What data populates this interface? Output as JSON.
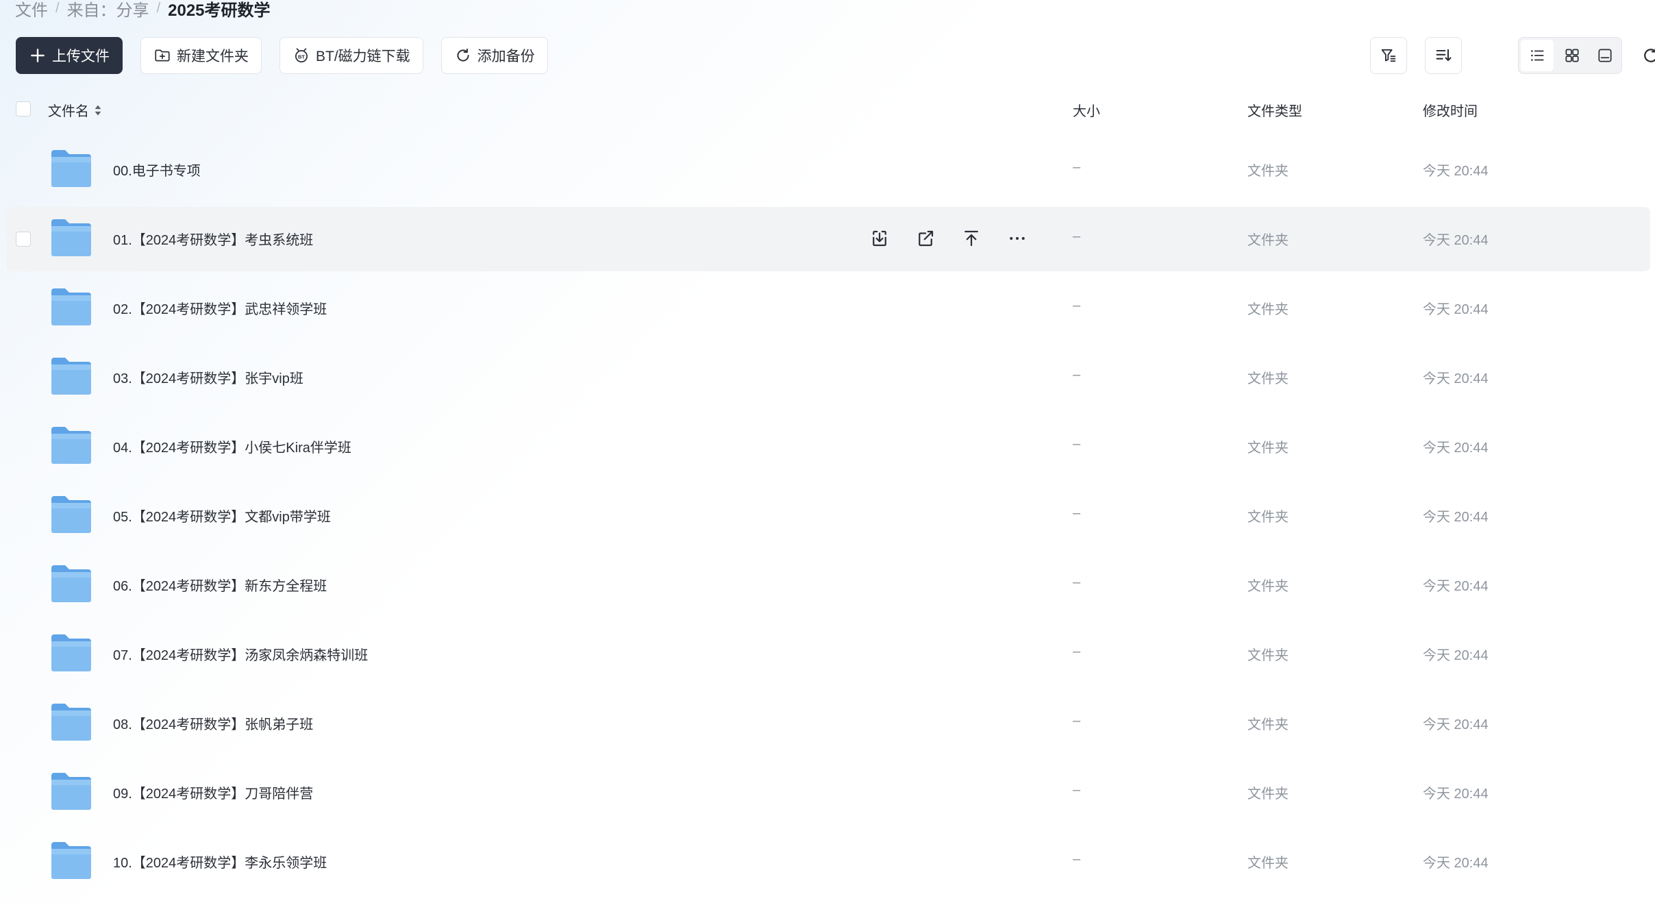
{
  "breadcrumb": {
    "root": "文件",
    "source": "来自：分享",
    "current": "2025考研数学",
    "separator": "/"
  },
  "toolbar": {
    "upload": "上传文件",
    "new_folder": "新建文件夹",
    "bt_download": "BT/磁力链下载",
    "add_backup": "添加备份"
  },
  "columns": {
    "name": "文件名",
    "size": "大小",
    "type": "文件类型",
    "modified": "修改时间"
  },
  "rows": [
    {
      "name": "00.电子书专项",
      "size": "–",
      "type": "文件夹",
      "modified": "今天 20:44"
    },
    {
      "name": "01.【2024考研数学】考虫系统班",
      "size": "–",
      "type": "文件夹",
      "modified": "今天 20:44"
    },
    {
      "name": "02.【2024考研数学】武忠祥领学班",
      "size": "–",
      "type": "文件夹",
      "modified": "今天 20:44"
    },
    {
      "name": "03.【2024考研数学】张宇vip班",
      "size": "–",
      "type": "文件夹",
      "modified": "今天 20:44"
    },
    {
      "name": "04.【2024考研数学】小侯七Kira伴学班",
      "size": "–",
      "type": "文件夹",
      "modified": "今天 20:44"
    },
    {
      "name": "05.【2024考研数学】文都vip带学班",
      "size": "–",
      "type": "文件夹",
      "modified": "今天 20:44"
    },
    {
      "name": "06.【2024考研数学】新东方全程班",
      "size": "–",
      "type": "文件夹",
      "modified": "今天 20:44"
    },
    {
      "name": "07.【2024考研数学】汤家凤余炳森特训班",
      "size": "–",
      "type": "文件夹",
      "modified": "今天 20:44"
    },
    {
      "name": "08.【2024考研数学】张帆弟子班",
      "size": "–",
      "type": "文件夹",
      "modified": "今天 20:44"
    },
    {
      "name": "09.【2024考研数学】刀哥陪伴营",
      "size": "–",
      "type": "文件夹",
      "modified": "今天 20:44"
    },
    {
      "name": "10.【2024考研数学】李永乐领学班",
      "size": "–",
      "type": "文件夹",
      "modified": "今天 20:44"
    }
  ],
  "row_actions_icons": [
    "download-icon",
    "share-icon",
    "move-to-top-icon",
    "more-icon"
  ],
  "colors": {
    "primary": "#2a3140",
    "folder": "#7ab6ee",
    "hover_row": "#f2f3f5",
    "muted_text": "#8f959e"
  }
}
